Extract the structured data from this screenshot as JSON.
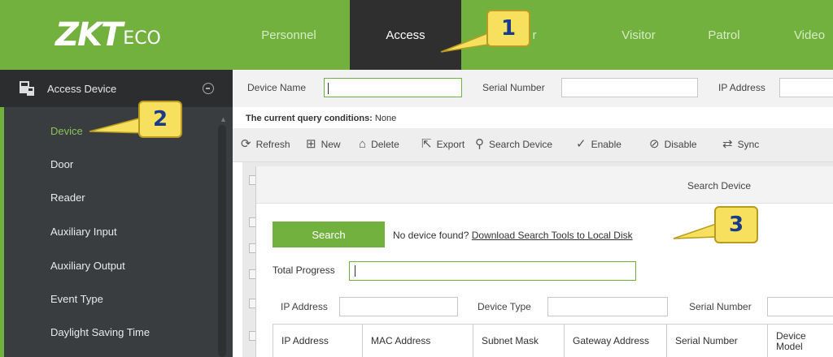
{
  "logo": {
    "main": "ZKT",
    "sub": "ECO"
  },
  "nav": [
    {
      "label": "Personnel",
      "active": false
    },
    {
      "label": "Access",
      "active": true
    },
    {
      "label": "r",
      "active": false
    },
    {
      "label": "Visitor",
      "active": false
    },
    {
      "label": "Patrol",
      "active": false
    },
    {
      "label": "Video",
      "active": false
    }
  ],
  "sidebar": {
    "group_label": "Access Device",
    "items": [
      {
        "label": "Device",
        "active": true
      },
      {
        "label": "Door",
        "active": false
      },
      {
        "label": "Reader",
        "active": false
      },
      {
        "label": "Auxiliary Input",
        "active": false
      },
      {
        "label": "Auxiliary Output",
        "active": false
      },
      {
        "label": "Event Type",
        "active": false
      },
      {
        "label": "Daylight Saving Time",
        "active": false
      }
    ]
  },
  "filters": {
    "device_name_label": "Device Name",
    "device_name_value": "",
    "serial_number_label": "Serial Number",
    "serial_number_value": "",
    "ip_address_label": "IP Address",
    "ip_address_value": ""
  },
  "query": {
    "label": "The current query conditions:",
    "value": "None"
  },
  "toolbar": {
    "refresh": "Refresh",
    "new": "New",
    "delete": "Delete",
    "export": "Export",
    "search_device": "Search Device",
    "enable": "Enable",
    "disable": "Disable",
    "sync": "Sync"
  },
  "dialog": {
    "title": "Search Device",
    "search_button": "Search",
    "hint_text": "No device found?",
    "hint_link": "Download Search Tools to Local Disk",
    "total_progress_label": "Total Progress",
    "total_progress": 0,
    "filter_ip_label": "IP Address",
    "filter_ip_value": "",
    "filter_type_label": "Device Type",
    "filter_type_value": "",
    "filter_serial_label": "Serial Number",
    "filter_serial_value": "",
    "columns": [
      "IP Address",
      "MAC Address",
      "Subnet Mask",
      "Gateway Address",
      "Serial Number",
      "Device Model"
    ]
  },
  "callouts": [
    "1",
    "2",
    "3"
  ],
  "colors": {
    "brand_green": "#73b13e",
    "nav_active_bg": "#2f2f2f",
    "sidebar_bg": "#393d3f",
    "callout_yellow": "#f8e05f"
  }
}
